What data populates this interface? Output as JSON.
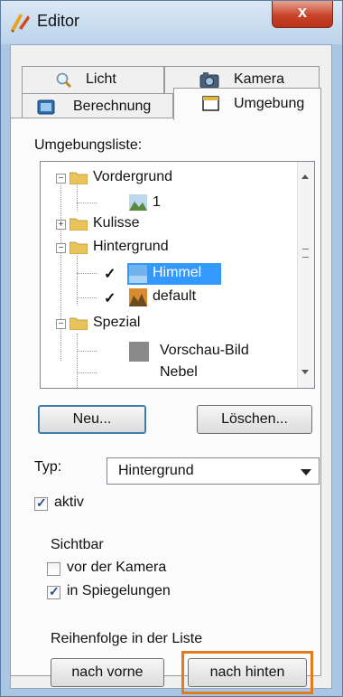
{
  "window": {
    "title": "Editor",
    "close_symbol": "x"
  },
  "tabs": [
    {
      "label": "Licht",
      "icon": "magnifier-icon"
    },
    {
      "label": "Kamera",
      "icon": "camera-icon"
    },
    {
      "label": "Berechnung",
      "icon": "monitor-icon"
    },
    {
      "label": "Umgebung",
      "icon": "window-icon",
      "selected": true
    }
  ],
  "environment": {
    "list_label": "Umgebungsliste:",
    "tree": {
      "vordergrund": "Vordergrund",
      "vordergrund_item": "1",
      "kulisse": "Kulisse",
      "hintergrund": "Hintergrund",
      "himmel": "Himmel",
      "default": "default",
      "spezial": "Spezial",
      "vorschau": "Vorschau-Bild",
      "nebel": "Nebel",
      "check_mark": "✓"
    },
    "new_button": "Neu...",
    "delete_button": "Löschen..."
  },
  "type": {
    "label": "Typ:",
    "value": "Hintergrund"
  },
  "active": {
    "label": "aktiv",
    "checked": true
  },
  "visibility": {
    "heading": "Sichtbar",
    "before_camera": {
      "label": "vor der Kamera",
      "checked": false
    },
    "in_reflections": {
      "label": "in Spiegelungen",
      "checked": true
    }
  },
  "order": {
    "heading": "Reihenfolge in der Liste",
    "forward_button": "nach vorne",
    "backward_button": "nach hinten"
  },
  "colors": {
    "selection": "#3399ff",
    "callout": "#e47b1b",
    "title_bar": "#bcd3ea"
  }
}
